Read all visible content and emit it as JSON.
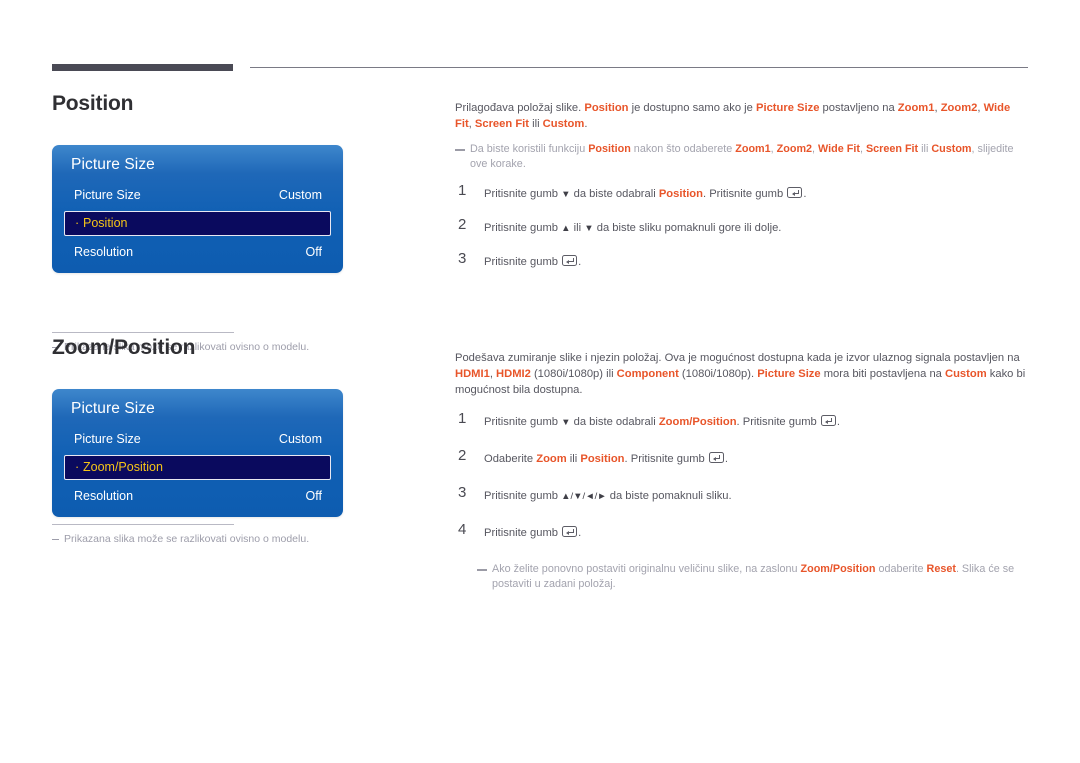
{
  "page": {
    "language": "hr",
    "accent_color": "#e8552a",
    "osd_blue_top": "#3e87cc",
    "osd_blue_bottom": "#0e5cb0",
    "osd_selected_bg": "#0a0a5e",
    "osd_selected_text": "#f5c518"
  },
  "sections": {
    "position": {
      "heading": "Position",
      "osd": {
        "title": "Picture Size",
        "rows": [
          {
            "label": "Picture Size",
            "value": "Custom",
            "selected": false
          },
          {
            "label": "Position",
            "value": "",
            "selected": true,
            "bullet": "·"
          },
          {
            "label": "Resolution",
            "value": "Off",
            "selected": false
          }
        ]
      },
      "footnote": "Prikazana slika može se razlikovati ovisno o modelu.",
      "intro": {
        "t1": "Prilagođava položaj slike. ",
        "b1": "Position",
        "t2": " je dostupno samo ako je ",
        "b2": "Picture Size",
        "t3": " postavljeno na ",
        "b3": "Zoom1",
        "t4": ", ",
        "b4": "Zoom2",
        "t5": ", ",
        "b5": "Wide Fit",
        "t6": ", ",
        "b6": "Screen Fit",
        "t7": " ili ",
        "b7": "Custom",
        "t8": "."
      },
      "subnote": {
        "t1": "Da biste koristili funkciju ",
        "b1": "Position",
        "t2": " nakon što odaberete ",
        "b2": "Zoom1",
        "t3": ", ",
        "b3": "Zoom2",
        "t4": ", ",
        "b4": "Wide Fit",
        "t5": ", ",
        "b5": "Screen Fit",
        "t6": " ili ",
        "b6": "Custom",
        "t7": ", slijedite ove korake."
      },
      "steps": [
        {
          "num": "1",
          "t1": "Pritisnite gumb ",
          "icon1": "arrow-down",
          "t2": " da biste odabrali ",
          "b1": "Position",
          "t3": ". Pritisnite gumb ",
          "icon2": "enter-button",
          "t4": "."
        },
        {
          "num": "2",
          "t1": "Pritisnite gumb ",
          "icon1": "arrow-up",
          "t2": " ili ",
          "icon2": "arrow-down",
          "t3": " da biste sliku pomaknuli gore ili dolje."
        },
        {
          "num": "3",
          "t1": "Pritisnite gumb ",
          "icon1": "enter-button",
          "t2": "."
        }
      ]
    },
    "zoom_position": {
      "heading": "Zoom/Position",
      "osd": {
        "title": "Picture Size",
        "rows": [
          {
            "label": "Picture Size",
            "value": "Custom",
            "selected": false
          },
          {
            "label": "Zoom/Position",
            "value": "",
            "selected": true,
            "bullet": "·"
          },
          {
            "label": "Resolution",
            "value": "Off",
            "selected": false
          }
        ]
      },
      "footnote": "Prikazana slika može se razlikovati ovisno o modelu.",
      "intro": {
        "t1": "Podešava zumiranje slike i njezin položaj. Ova je mogućnost dostupna kada je izvor ulaznog signala postavljen na ",
        "b1": "HDMI1",
        "t2": ", ",
        "b2": "HDMI2",
        "t3": " (1080i/1080p) ili ",
        "b3": "Component",
        "t4": " (1080i/1080p). ",
        "b4": "Picture Size",
        "t5": " mora biti postavljena na ",
        "b5": "Custom",
        "t6": " kako bi mogućnost bila dostupna."
      },
      "steps": [
        {
          "num": "1",
          "t1": "Pritisnite gumb ",
          "icon1": "arrow-down",
          "t2": " da biste odabrali ",
          "b1": "Zoom/Position",
          "t3": ". Pritisnite gumb ",
          "icon2": "enter-button",
          "t4": "."
        },
        {
          "num": "2",
          "t1": "Odaberite ",
          "b1": "Zoom",
          "t2": " ili ",
          "b2": "Position",
          "t3": ". Pritisnite gumb ",
          "icon1": "enter-button",
          "t4": "."
        },
        {
          "num": "3",
          "t1": "Pritisnite gumb ",
          "icons": "arrow-up-down-left-right",
          "t2": " da biste pomaknuli sliku."
        },
        {
          "num": "4",
          "t1": "Pritisnite gumb ",
          "icon1": "enter-button",
          "t2": "."
        }
      ],
      "subnote": {
        "t1": "Ako želite ponovno postaviti originalnu veličinu slike, na zaslonu ",
        "b1": "Zoom/Position",
        "t2": " odaberite ",
        "b2": "Reset",
        "t3": ". Slika će se postaviti u zadani položaj."
      }
    }
  }
}
